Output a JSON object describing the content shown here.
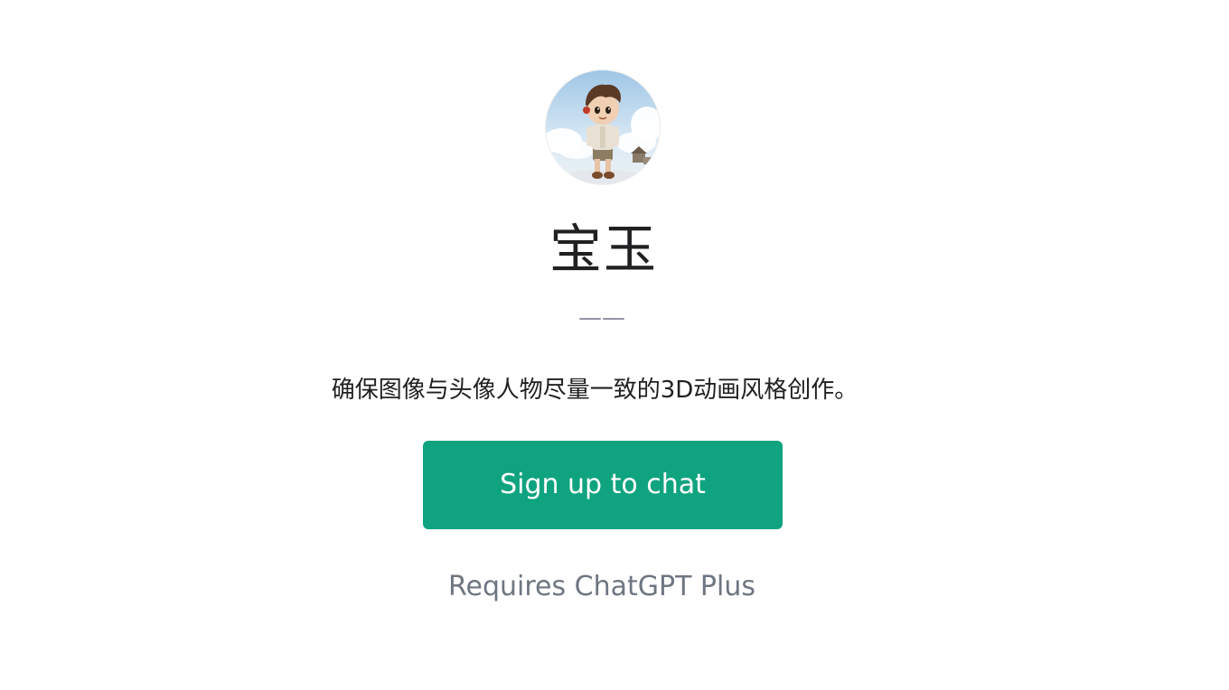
{
  "gpt": {
    "avatar_icon": "cartoon-boy-avatar",
    "name": "宝玉",
    "author_line": "——",
    "description": "确保图像与头像人物尽量一致的3D动画风格创作。"
  },
  "actions": {
    "signup_label": "Sign up to chat"
  },
  "footer": {
    "requires_text": "Requires ChatGPT Plus"
  },
  "colors": {
    "accent": "#10a37f",
    "title": "#202123",
    "muted": "#6e7681"
  }
}
